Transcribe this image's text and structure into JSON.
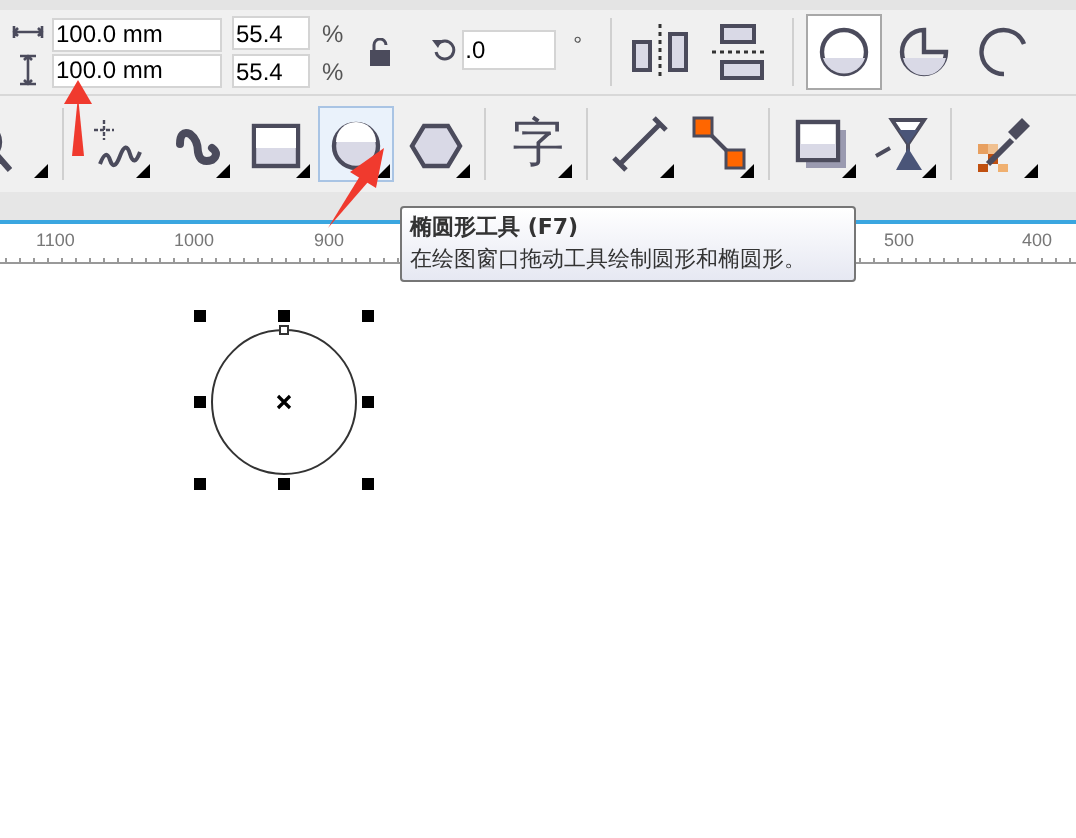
{
  "property_bar": {
    "width": {
      "value": "100.0 mm"
    },
    "height": {
      "value": "100.0 mm"
    },
    "scale_x": {
      "value": "55.4",
      "unit": "%"
    },
    "scale_y": {
      "value": "55.4",
      "unit": "%"
    },
    "rotation": {
      "value": ".0",
      "unit": "°"
    },
    "shape_buttons": [
      {
        "kind": "ellipse",
        "selected": true
      },
      {
        "kind": "pie",
        "selected": false
      },
      {
        "kind": "arc",
        "selected": false
      }
    ]
  },
  "toolbox": {
    "tools": [
      {
        "kind": "zoom",
        "selected": false
      },
      {
        "kind": "freehand",
        "selected": false
      },
      {
        "kind": "artistic",
        "selected": false
      },
      {
        "kind": "rectangle",
        "selected": false
      },
      {
        "kind": "ellipse",
        "selected": true
      },
      {
        "kind": "polygon",
        "selected": false
      },
      {
        "kind": "text",
        "label": "字",
        "selected": false
      },
      {
        "kind": "dimension",
        "selected": false
      },
      {
        "kind": "connector",
        "selected": false
      },
      {
        "kind": "shadow",
        "selected": false
      },
      {
        "kind": "transparency",
        "selected": false
      },
      {
        "kind": "eyedropper",
        "selected": false
      }
    ]
  },
  "ruler": {
    "labels": [
      "1100",
      "1000",
      "900",
      "500",
      "400"
    ]
  },
  "tooltip": {
    "title": "椭圆形工具 (F7)",
    "description": "在绘图窗口拖动工具绘制圆形和椭圆形。"
  }
}
